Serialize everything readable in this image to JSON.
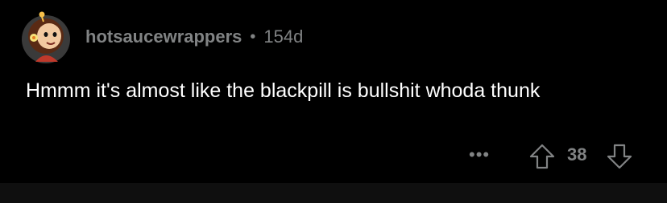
{
  "comment": {
    "author": "hotsaucewrappers",
    "separator": "•",
    "age": "154d",
    "body": "Hmmm it's almost like the blackpill is bullshit whoda thunk",
    "more_label": "•••",
    "score": "38",
    "icons": {
      "avatar": "avatar-cartoon-girl",
      "upvote": "upvote-arrow-icon",
      "downvote": "downvote-arrow-icon",
      "more": "more-options-icon"
    }
  },
  "colors": {
    "background": "#000000",
    "meta_text": "#818384",
    "body_text": "#ffffff",
    "divider": "#0f0f0f"
  }
}
